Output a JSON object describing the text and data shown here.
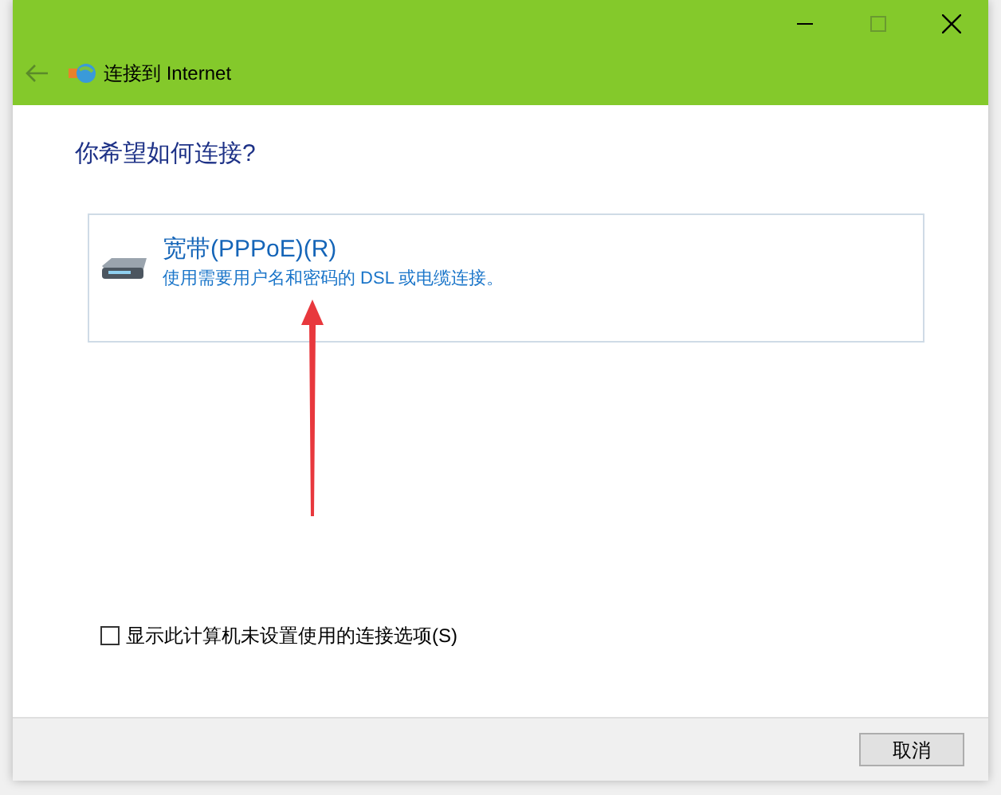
{
  "window": {
    "title": "连接到 Internet"
  },
  "heading": "你希望如何连接?",
  "options": [
    {
      "title": "宽带(PPPoE)(R)",
      "description": "使用需要用户名和密码的 DSL 或电缆连接。"
    }
  ],
  "show_unconfigured": {
    "label": "显示此计算机未设置使用的连接选项(S)",
    "checked": false
  },
  "buttons": [
    "取消"
  ]
}
